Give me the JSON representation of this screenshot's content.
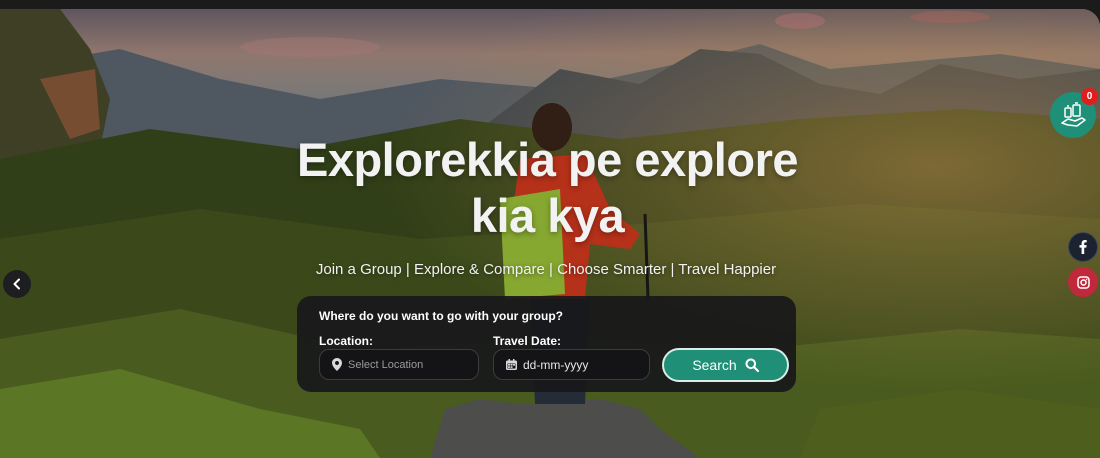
{
  "hero": {
    "headline_line1": "Explorekkia pe explore",
    "headline_line2": "kia kya",
    "tagline": "Join a Group | Explore & Compare | Choose Smarter | Travel Happier"
  },
  "search": {
    "title": "Where do you want to go with your group?",
    "location_label": "Location:",
    "location_placeholder": "Select Location",
    "date_label": "Travel Date:",
    "date_value": "dd-mm-yyyy",
    "button_label": "Search"
  },
  "floating": {
    "group_badge_count": "0"
  },
  "colors": {
    "accent": "#1f8f78",
    "badge": "#e01e1e",
    "instagram": "#c0283c"
  },
  "icons": [
    "chevron-left-icon",
    "map-pin-icon",
    "calendar-icon",
    "search-icon",
    "group-travel-icon",
    "facebook-icon",
    "instagram-icon"
  ]
}
